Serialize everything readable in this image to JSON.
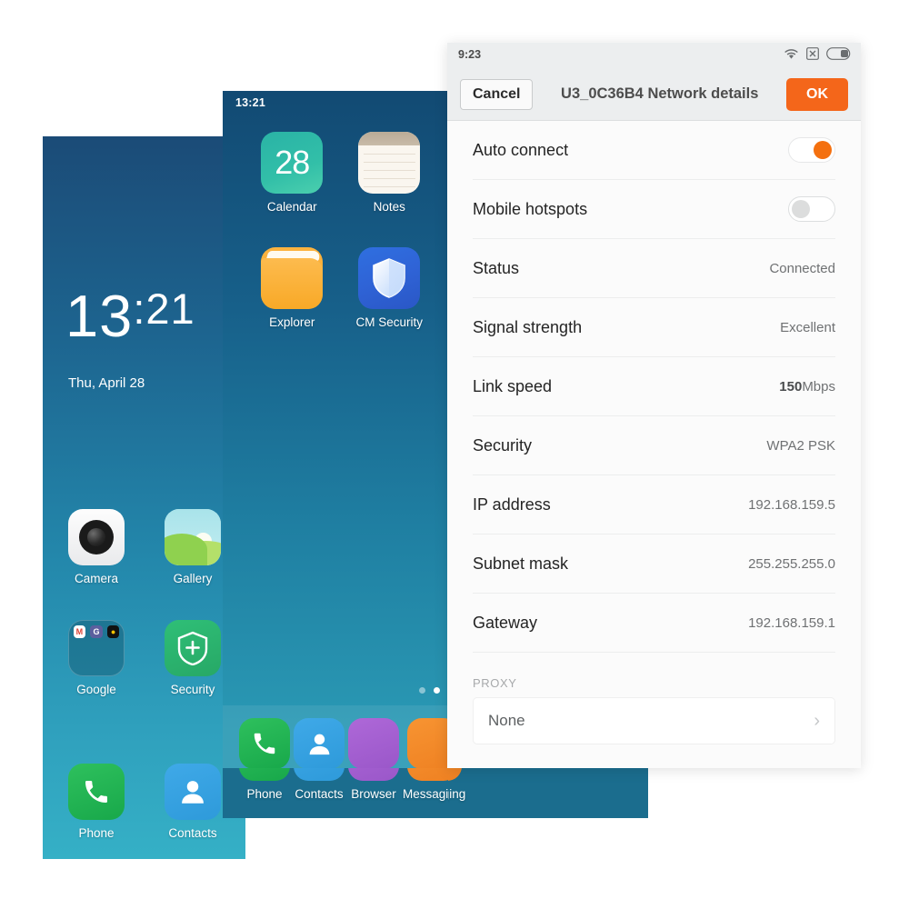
{
  "lockscreen": {
    "time_hours": "13",
    "time_sep": ":",
    "time_minutes": "21",
    "date": "Thu, April 28"
  },
  "phone_left": {
    "apps": [
      {
        "label": "Camera",
        "icon": "camera-icon"
      },
      {
        "label": "Gallery",
        "icon": "gallery-icon"
      },
      {
        "label": "Google",
        "icon": "google-folder-icon"
      },
      {
        "label": "Security",
        "icon": "shield-plus-icon"
      }
    ],
    "folder_minis": [
      "gmail-icon",
      "google-icon",
      "hangouts-icon"
    ],
    "dock": [
      {
        "label": "Phone",
        "icon": "phone-handset-icon"
      },
      {
        "label": "Contacts",
        "icon": "person-icon"
      }
    ]
  },
  "phone_mid": {
    "status_time": "13:21",
    "apps": [
      {
        "label": "Calendar",
        "icon": "calendar-icon",
        "badge": "28"
      },
      {
        "label": "Notes",
        "icon": "notes-icon"
      },
      {
        "label": "Explorer",
        "icon": "folder-icon"
      },
      {
        "label": "CM Security",
        "icon": "shield-icon"
      }
    ],
    "dock": [
      {
        "label": "Phone",
        "icon": "phone-handset-icon"
      },
      {
        "label": "Contacts",
        "icon": "person-icon"
      },
      {
        "label": "Browser",
        "icon": "browser-icon"
      },
      {
        "label": "Messaging",
        "icon": "messaging-icon"
      }
    ],
    "page_dots": 2,
    "page_active": 2
  },
  "panel": {
    "status_time": "9:23",
    "status_icons": [
      "wifi-icon",
      "no-signal-icon",
      "battery-icon"
    ],
    "cancel_label": "Cancel",
    "title": "U3_0C36B4 Network details",
    "ok_label": "OK",
    "rows": [
      {
        "key": "Auto connect",
        "type": "toggle",
        "state": "on"
      },
      {
        "key": "Mobile hotspots",
        "type": "toggle",
        "state": "off"
      },
      {
        "key": "Status",
        "type": "value",
        "value": "Connected"
      },
      {
        "key": "Signal strength",
        "type": "value",
        "value": "Excellent"
      },
      {
        "key": "Link speed",
        "type": "value",
        "value": "150Mbps",
        "value_bold": "150",
        "value_rest": "Mbps"
      },
      {
        "key": "Security",
        "type": "value",
        "value": "WPA2 PSK"
      },
      {
        "key": "IP address",
        "type": "value",
        "value": "192.168.159.5"
      },
      {
        "key": "Subnet mask",
        "type": "value",
        "value": "255.255.255.0"
      },
      {
        "key": "Gateway",
        "type": "value",
        "value": "192.168.159.1"
      }
    ],
    "proxy_section_label": "PROXY",
    "proxy_value": "None"
  },
  "colors": {
    "accent_orange": "#f4661a",
    "toggle_on": "#f4700f",
    "panel_bg": "#fbfbfb",
    "titlebar_bg": "#eceeef",
    "text_primary": "#242424",
    "text_secondary": "#6f7173"
  }
}
